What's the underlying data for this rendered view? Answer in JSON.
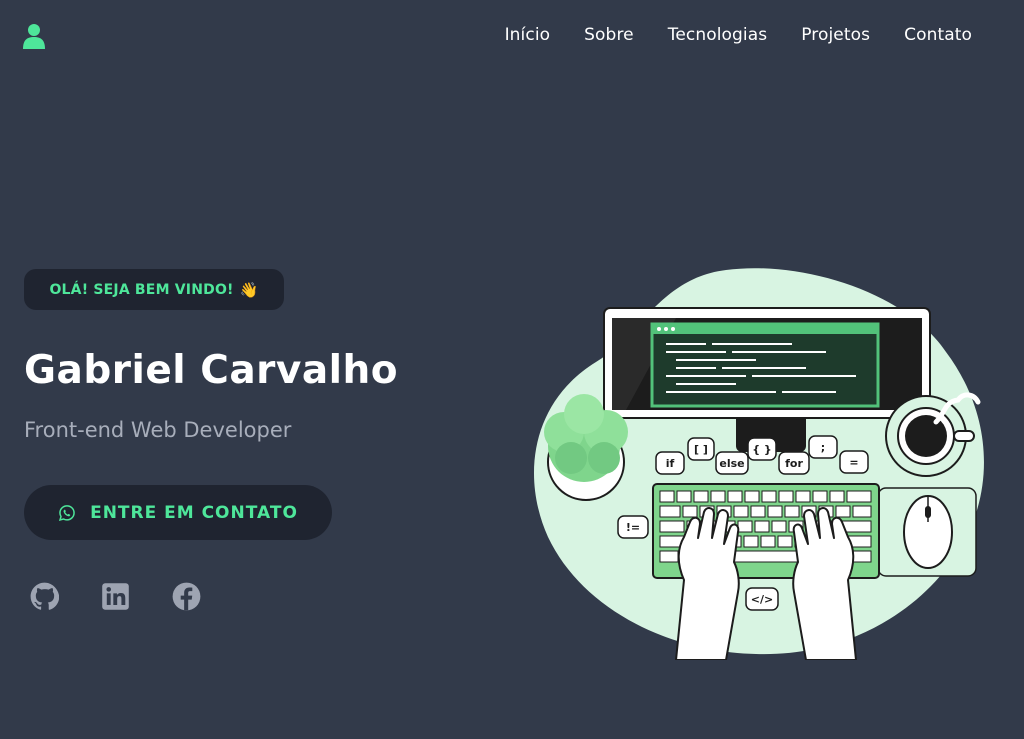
{
  "nav": {
    "items": [
      {
        "label": "Início"
      },
      {
        "label": "Sobre"
      },
      {
        "label": "Tecnologias"
      },
      {
        "label": "Projetos"
      },
      {
        "label": "Contato"
      }
    ]
  },
  "hero": {
    "badge": "OLÁ! SEJA BEM VINDO!",
    "badge_emoji": "👋",
    "name": "Gabriel Carvalho",
    "role": "Front-end Web Developer",
    "cta": "ENTRE EM CONTATO"
  },
  "socials": [
    {
      "icon": "github-icon"
    },
    {
      "icon": "linkedin-icon"
    },
    {
      "icon": "facebook-icon"
    }
  ],
  "illustration": {
    "bubbles": [
      "if",
      "[ ]",
      "else",
      "{ }",
      "for",
      ";",
      "=",
      "!=",
      "</>"
    ]
  },
  "colors": {
    "background": "#323a4a",
    "accent": "#4ee69a",
    "card": "#1f2430",
    "muted": "#a8aebb"
  }
}
